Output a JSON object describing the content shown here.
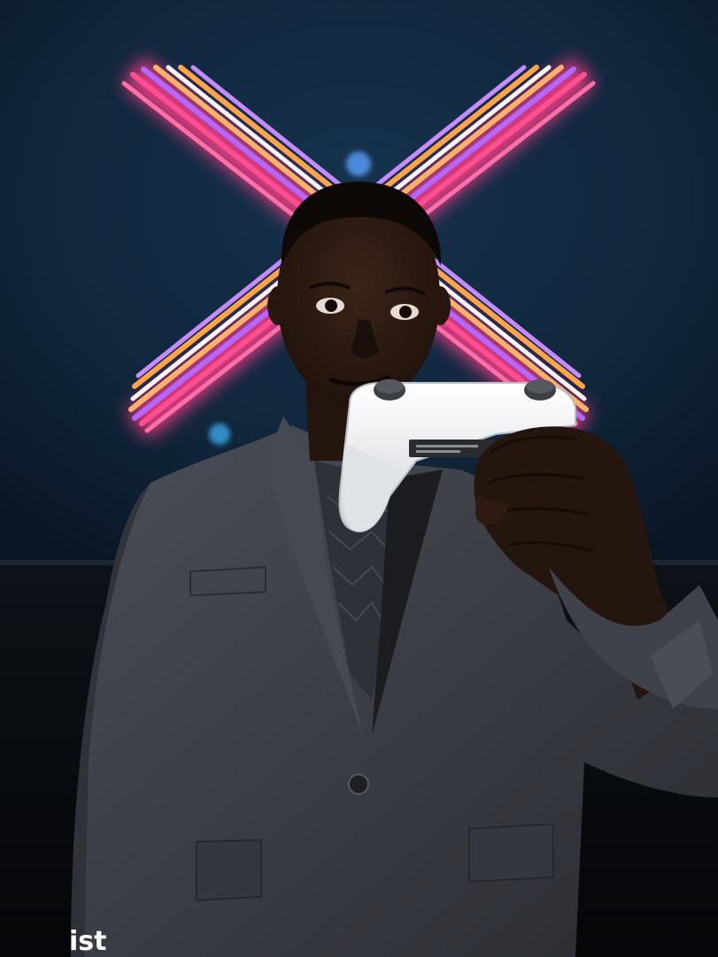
{
  "photo": {
    "caption_text": "ist",
    "colors": {
      "wall": "#10263c",
      "floor": "#07090c",
      "neon_pink": "#ff3d8b",
      "neon_orange": "#ffae5c",
      "neon_violet": "#a35bff",
      "neon_white": "#fff2f6",
      "suit": "#3a3d44",
      "skin": "#2b1a12",
      "controller": "#e9ebee"
    },
    "icons": {
      "sign": "neon-x-sign",
      "object": "game-controller"
    }
  }
}
